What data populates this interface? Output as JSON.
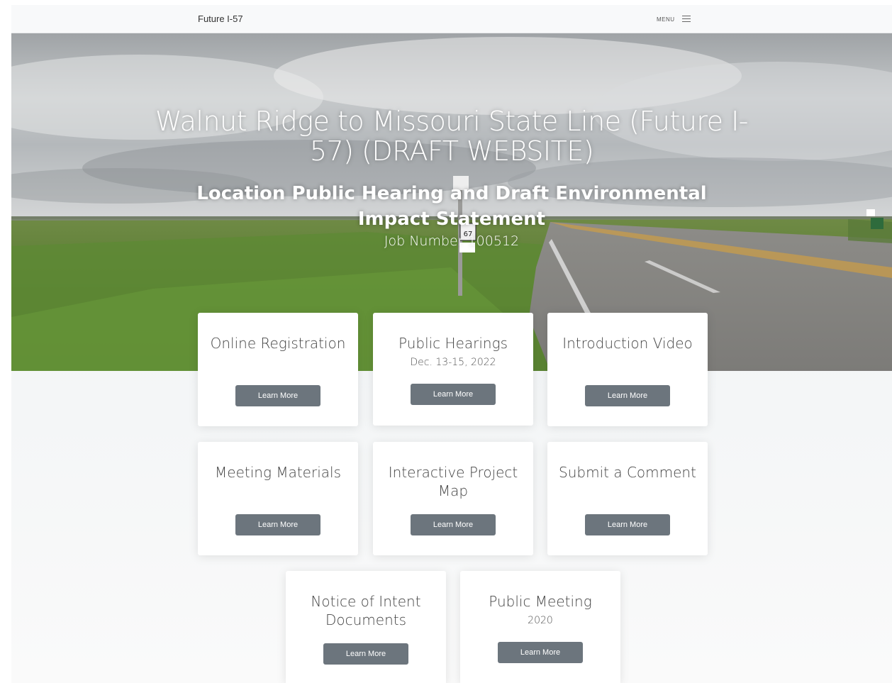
{
  "navbar": {
    "brand": "Future I-57",
    "menu_label": "MENU"
  },
  "hero": {
    "title": "Walnut Ridge to Missouri State Line (Future I-57) (DRAFT WEBSITE)",
    "subtitle": "Location Public Hearing and Draft Environmental Impact Statement",
    "job_number": "Job Number 100512",
    "route_sign": "67"
  },
  "cards": [
    {
      "title": "Online Registration",
      "date": "",
      "button": "Learn More"
    },
    {
      "title": "Public Hearings",
      "date": "Dec. 13-15, 2022",
      "button": "Learn More"
    },
    {
      "title": "Introduction Video",
      "date": "",
      "button": "Learn More"
    },
    {
      "title": "Meeting Materials",
      "date": "",
      "button": "Learn More"
    },
    {
      "title": "Interactive Project Map",
      "date": "",
      "button": "Learn More"
    },
    {
      "title": "Submit a Comment",
      "date": "",
      "button": "Learn More"
    },
    {
      "title": "Notice of Intent Documents",
      "date": "",
      "button": "Learn More"
    },
    {
      "title": "Public Meeting",
      "date": "2020",
      "button": "Learn More"
    }
  ],
  "colors": {
    "button": "#6c757d",
    "navbar": "#f8f9fa",
    "page_bg": "#eef1f3"
  }
}
